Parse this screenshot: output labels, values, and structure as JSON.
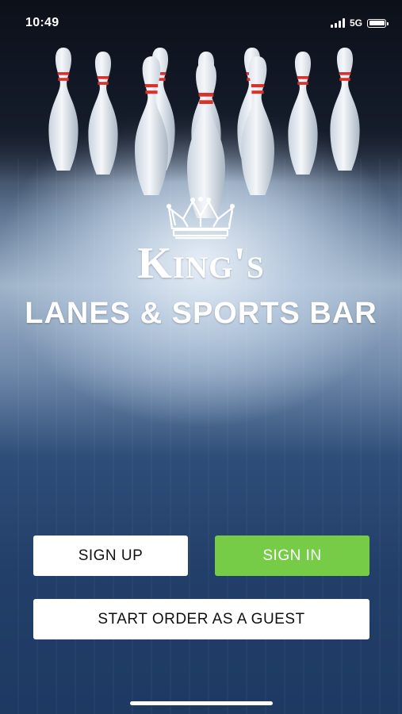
{
  "status_bar": {
    "time": "10:49",
    "network": "5G",
    "icons": [
      "signal-icon",
      "battery-icon"
    ]
  },
  "brand": {
    "name": "King's",
    "subtitle": "LANES & SPORTS BAR",
    "logo_icon": "crown-icon"
  },
  "buttons": {
    "sign_up": "SIGN UP",
    "sign_in": "SIGN IN",
    "guest": "START ORDER AS A GUEST"
  },
  "colors": {
    "sign_in_bg": "#76cc46",
    "background": "#1e3a63"
  }
}
